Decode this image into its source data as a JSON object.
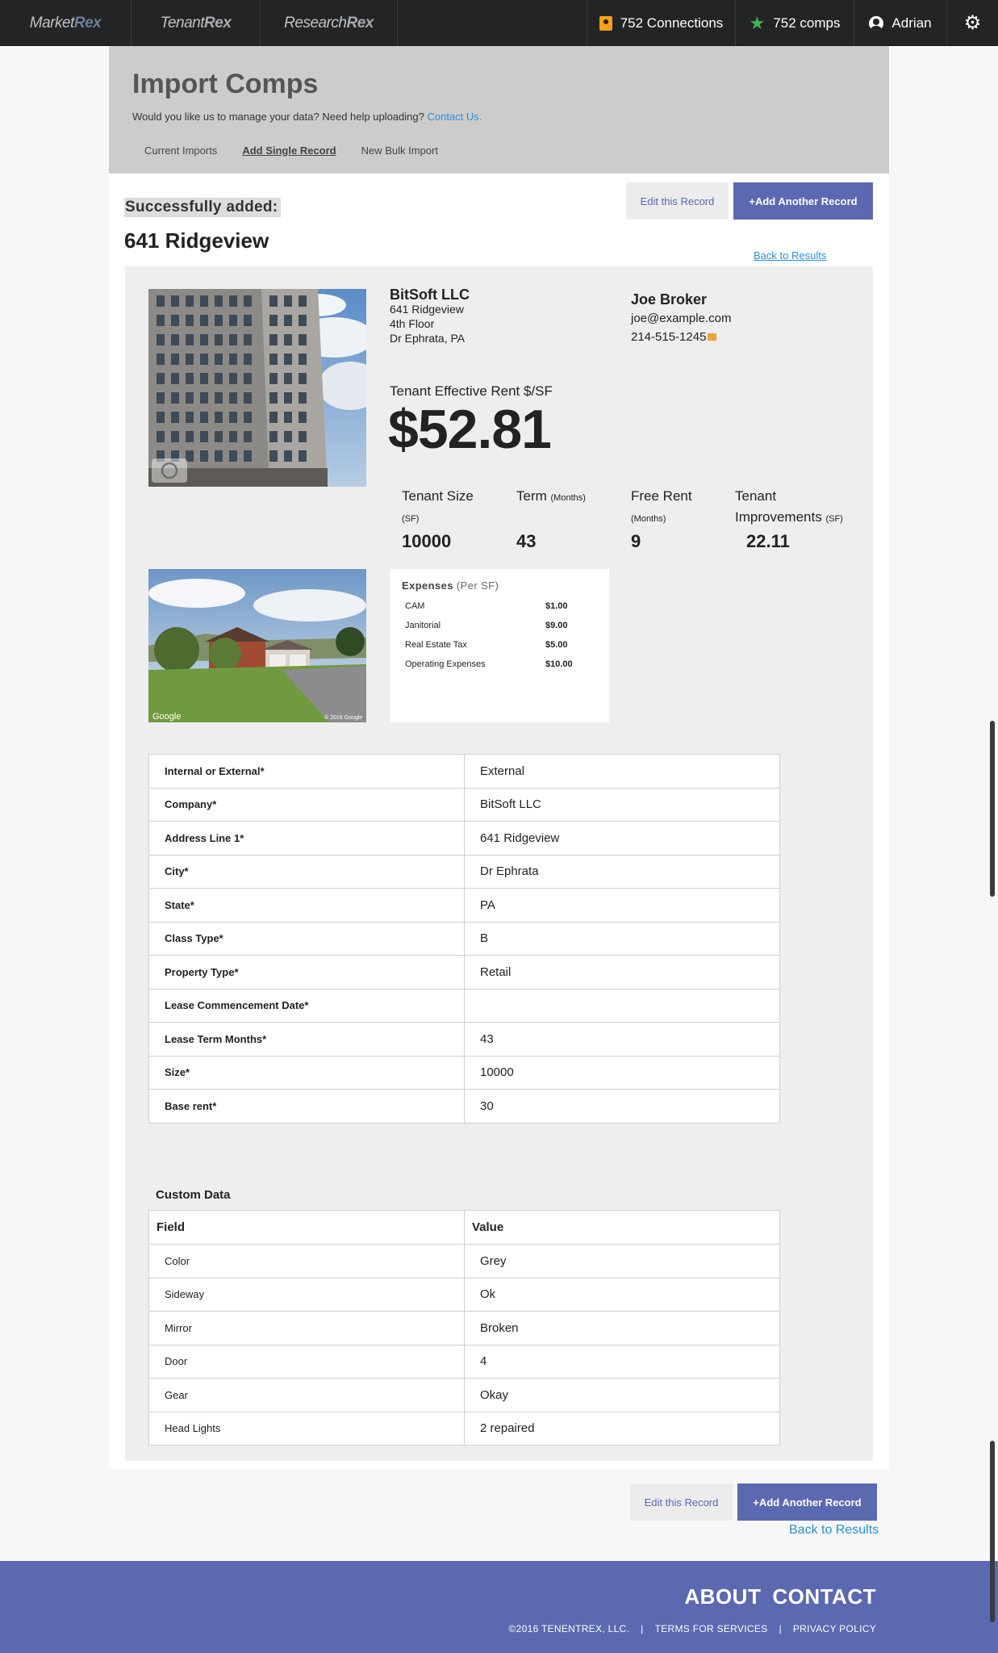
{
  "nav": {
    "brands": [
      {
        "prefix": "Market",
        "suffix": "Rex"
      },
      {
        "prefix": "Tenant",
        "suffix": "Rex"
      },
      {
        "prefix": "Research",
        "suffix": "Rex"
      }
    ],
    "connections": "752 Connections",
    "comps": "752 comps",
    "user": "Adrian"
  },
  "header": {
    "title": "Import Comps",
    "subtitle": "Would you like us to manage your data? Need help uploading?",
    "contact_link": "Contact Us.",
    "tabs": [
      "Current Imports",
      "Add Single Record",
      "New Bulk Import"
    ]
  },
  "status": {
    "success": "Successfully added:",
    "address": "641 Ridgeview"
  },
  "actions": {
    "edit": "Edit this Record",
    "add": "+Add Another Record",
    "back": "Back to Results"
  },
  "record": {
    "company": "BitSoft LLC",
    "address1": "641 Ridgeview",
    "address2": "4th Floor",
    "city_state": "Dr Ephrata, PA",
    "broker_name": "Joe Broker",
    "broker_email": "joe@example.com",
    "broker_phone": "214-515-1245",
    "rent_label": "Tenant Effective Rent $/SF",
    "rent_value": "$52.81",
    "stats": {
      "size_label": "Tenant Size",
      "size_unit": "(SF)",
      "size_value": "10000",
      "term_label": "Term",
      "term_unit": "(Months)",
      "term_value": "43",
      "free_label": "Free Rent",
      "free_unit": "(Months)",
      "free_value": "9",
      "ti_label1": "Tenant",
      "ti_label2": "Improvements",
      "ti_unit": "(SF)",
      "ti_value": "22.11"
    },
    "expenses": {
      "title": "Expenses",
      "unit": "(Per SF)",
      "rows": [
        {
          "name": "CAM",
          "value": "$1.00"
        },
        {
          "name": "Janitorial",
          "value": "$9.00"
        },
        {
          "name": "Real Estate Tax",
          "value": "$5.00"
        },
        {
          "name": "Operating Expenses",
          "value": "$10.00"
        }
      ]
    },
    "street_credit": "Google",
    "street_copyright": "© 2016 Google"
  },
  "fields": [
    {
      "key": "Internal or External*",
      "value": "External"
    },
    {
      "key": "Company*",
      "value": "BitSoft LLC"
    },
    {
      "key": "Address Line 1*",
      "value": "641 Ridgeview"
    },
    {
      "key": "City*",
      "value": "Dr Ephrata"
    },
    {
      "key": "State*",
      "value": "PA"
    },
    {
      "key": "Class Type*",
      "value": "B"
    },
    {
      "key": "Property Type*",
      "value": "Retail"
    },
    {
      "key": "Lease Commencement Date*",
      "value": ""
    },
    {
      "key": "Lease Term Months*",
      "value": "43"
    },
    {
      "key": "Size*",
      "value": "10000"
    },
    {
      "key": "Base rent*",
      "value": "30"
    }
  ],
  "custom": {
    "title": "Custom Data",
    "col_field": "Field",
    "col_value": "Value",
    "rows": [
      {
        "key": "Color",
        "value": "Grey"
      },
      {
        "key": "Sideway",
        "value": "Ok"
      },
      {
        "key": "Mirror",
        "value": "Broken"
      },
      {
        "key": "Door",
        "value": "4"
      },
      {
        "key": "Gear",
        "value": "Okay"
      },
      {
        "key": "Head Lights",
        "value": "2 repaired"
      }
    ]
  },
  "footer": {
    "about": "ABOUT",
    "contact": "CONTACT",
    "copyright": "©2016 TENENTREX, LLC.",
    "terms": "TERMS FOR SERVICES",
    "privacy": "PRIVACY POLICY"
  }
}
